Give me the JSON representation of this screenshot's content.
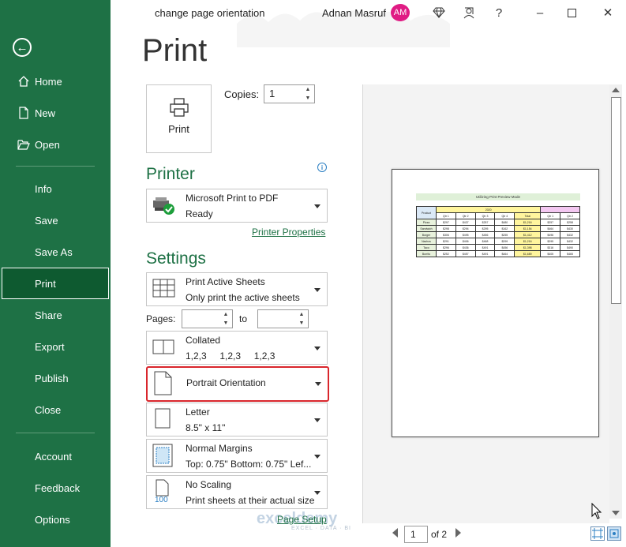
{
  "titlebar": {
    "doc_title": "change page orientation",
    "user_name": "Adnan Masruf",
    "avatar_initials": "AM",
    "icons": [
      "diamond-icon",
      "share-people-icon",
      "help-icon",
      "minimize-icon",
      "restore-icon",
      "close-icon"
    ]
  },
  "sidebar": {
    "items": [
      {
        "label": "Home",
        "icon": "home-icon"
      },
      {
        "label": "New",
        "icon": "new-document-icon"
      },
      {
        "label": "Open",
        "icon": "folder-open-icon"
      },
      {
        "label": "Info"
      },
      {
        "label": "Save"
      },
      {
        "label": "Save As"
      },
      {
        "label": "Print",
        "active": true
      },
      {
        "label": "Share"
      },
      {
        "label": "Export"
      },
      {
        "label": "Publish"
      },
      {
        "label": "Close"
      },
      {
        "label": "Account"
      },
      {
        "label": "Feedback"
      },
      {
        "label": "Options"
      }
    ],
    "accent": "#1e7145"
  },
  "main": {
    "heading": "Print",
    "print_button": "Print",
    "copies_label": "Copies:",
    "copies_value": "1",
    "printer_heading": "Printer",
    "printer": {
      "name": "Microsoft Print to PDF",
      "status": "Ready"
    },
    "printer_properties": "Printer Properties",
    "settings_heading": "Settings",
    "settings": {
      "what": {
        "line1": "Print Active Sheets",
        "line2": "Only print the active sheets"
      },
      "pages_label": "Pages:",
      "to_label": "to",
      "collation": {
        "line1": "Collated",
        "line2": "1,2,3     1,2,3     1,2,3"
      },
      "orientation": {
        "line1": "Portrait Orientation"
      },
      "paper": {
        "line1": "Letter",
        "line2": "8.5\" x 11\""
      },
      "margins": {
        "line1": "Normal Margins",
        "line2": "Top: 0.75\" Bottom: 0.75\" Lef..."
      },
      "scaling": {
        "line1": "No Scaling",
        "line2": "Print sheets at their actual size",
        "icon_text": "100"
      }
    },
    "page_setup": "Page Setup"
  },
  "preview": {
    "sheet_title": "Utilizing Print Preview Mode",
    "year_header": "2020",
    "product_header": "Product",
    "columns": [
      "Qtr 1",
      "Qtr 2",
      "Qtr 3",
      "Qtr 4",
      "Total",
      "Qtr 1",
      "Qtr 2"
    ],
    "rows": [
      [
        "Pizza",
        "$297",
        "$437",
        "$257",
        "$480",
        "$1,216",
        "$257",
        "$258"
      ],
      [
        "Sandwich",
        "$298",
        "$294",
        "$295",
        "$162",
        "$1,154",
        "$464",
        "$430"
      ],
      [
        "Burger",
        "$306",
        "$495",
        "$456",
        "$255",
        "$1,412",
        "$496",
        "$432"
      ],
      [
        "Nachos",
        "$291",
        "$406",
        "$468",
        "$299",
        "$1,216",
        "$295",
        "$432"
      ],
      [
        "Taco",
        "$296",
        "$436",
        "$491",
        "$456",
        "$1,398",
        "$316",
        "$490"
      ],
      [
        "Burrito",
        "$252",
        "$457",
        "$491",
        "$464",
        "$1,689",
        "$405",
        "$465"
      ]
    ],
    "page_current": "1",
    "page_of": "of 2"
  },
  "watermark": {
    "brand": "exceldemy",
    "tagline": "EXCEL · DATA · BI"
  }
}
